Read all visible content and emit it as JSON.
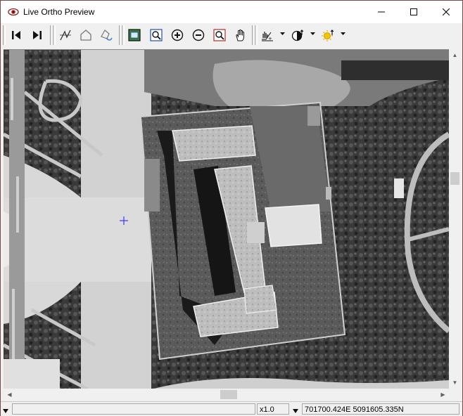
{
  "window": {
    "title": "Live Ortho Preview",
    "minimize_glyph": "—",
    "maximize_glyph": "☐",
    "close_glyph": "✕"
  },
  "toolbar": {
    "buttons": [
      {
        "name": "previous-image-button",
        "icon": "skip-back-icon"
      },
      {
        "name": "next-image-button",
        "icon": "skip-forward-icon"
      },
      {
        "name": "draw-polyline-button",
        "icon": "polyline-icon"
      },
      {
        "name": "draw-polygon-button",
        "icon": "polygon-icon"
      },
      {
        "name": "edit-polygon-button",
        "icon": "polygon-edit-icon"
      },
      {
        "name": "zoom-extents-button",
        "icon": "zoom-extents-icon"
      },
      {
        "name": "zoom-window-button",
        "icon": "zoom-window-icon"
      },
      {
        "name": "zoom-in-button",
        "icon": "zoom-in-icon"
      },
      {
        "name": "zoom-out-button",
        "icon": "zoom-out-icon"
      },
      {
        "name": "zoom-selection-button",
        "icon": "zoom-selection-icon"
      },
      {
        "name": "pan-button",
        "icon": "hand-icon"
      },
      {
        "name": "histogram-button",
        "icon": "histogram-icon"
      },
      {
        "name": "contrast-button",
        "icon": "contrast-icon"
      },
      {
        "name": "brightness-button",
        "icon": "brightness-icon"
      }
    ]
  },
  "status": {
    "left_field": "",
    "zoom": "x1.0",
    "coordinates": "701700.424E 5091605.335N"
  },
  "colors": {
    "cursor_cross": "#3a3aff",
    "window_border": "#7a4a4a"
  }
}
